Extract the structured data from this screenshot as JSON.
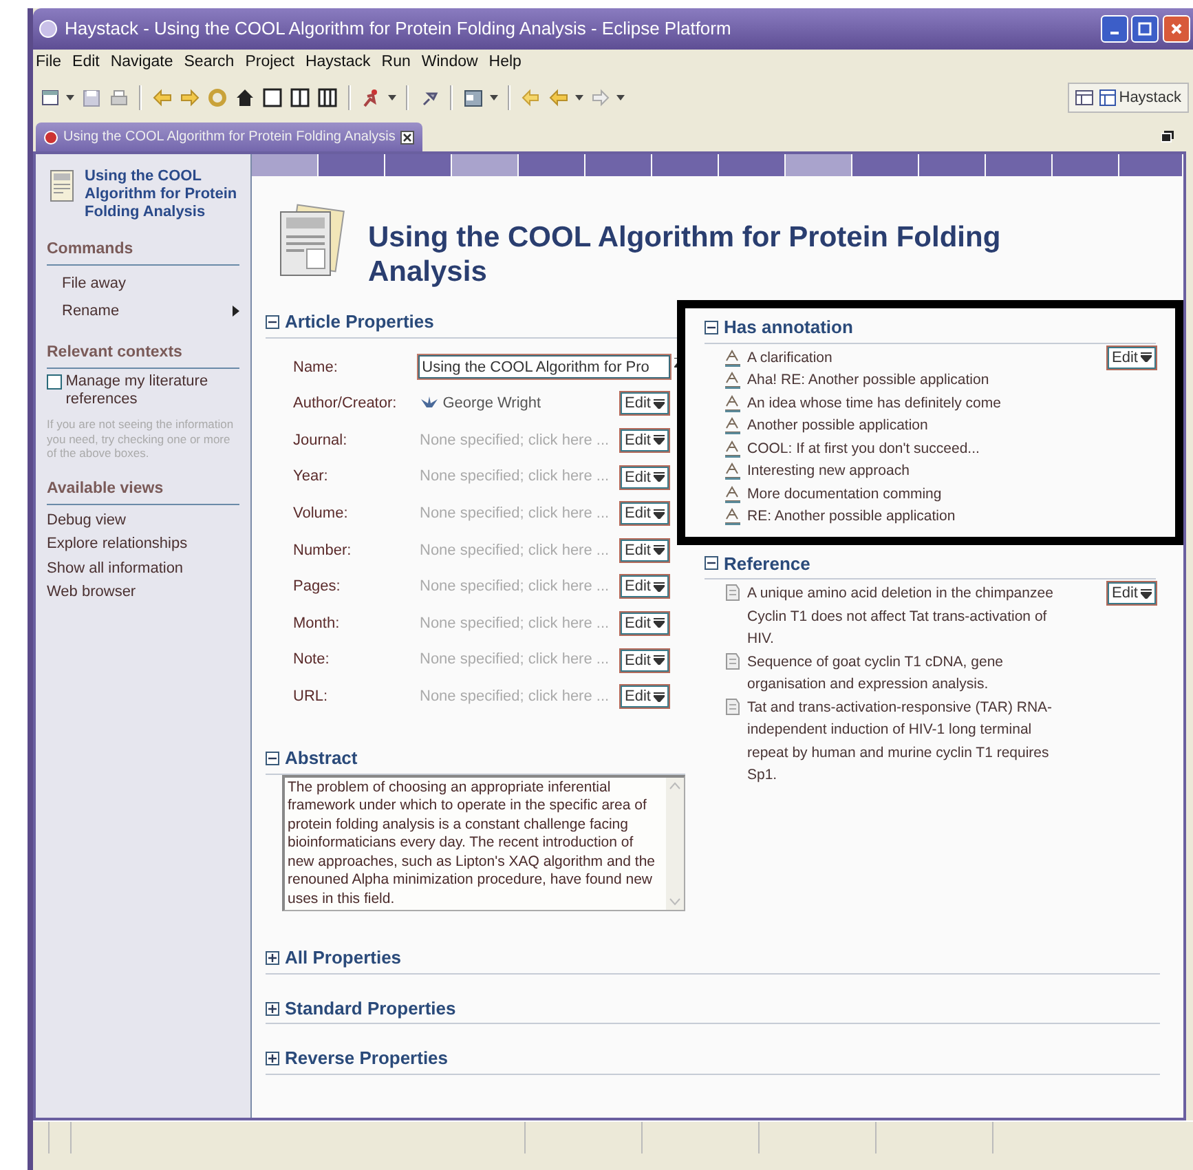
{
  "window": {
    "title": "Haystack - Using the COOL Algorithm for Protein Folding Analysis - Eclipse Platform"
  },
  "menu": [
    "File",
    "Edit",
    "Navigate",
    "Search",
    "Project",
    "Haystack",
    "Run",
    "Window",
    "Help"
  ],
  "perspective": "Haystack",
  "editor_tab": {
    "label": "Using the COOL Algorithm for Protein Folding Analysis"
  },
  "sidebar": {
    "title": "Using the COOL Algorithm for Protein Folding Analysis",
    "sections": [
      {
        "heading": "Commands",
        "kind": "commands",
        "items": [
          {
            "label": "File away",
            "submenu": false
          },
          {
            "label": "Rename",
            "submenu": true
          }
        ]
      },
      {
        "heading": "Relevant contexts",
        "kind": "contexts",
        "items": [
          {
            "label": "Manage my literature references",
            "checked": false
          }
        ],
        "hint": "If you are not seeing the information you need, try checking one or more of the above boxes."
      },
      {
        "heading": "Available views",
        "kind": "views",
        "items": [
          {
            "label": "Debug view"
          },
          {
            "label": "Explore relationships"
          },
          {
            "label": "Show all information"
          },
          {
            "label": "Web browser"
          }
        ]
      }
    ]
  },
  "main": {
    "title": "Using the COOL Algorithm for Protein Folding Analysis",
    "article_properties": {
      "heading": "Article Properties",
      "expanded": true,
      "rows": [
        {
          "label": "Name:",
          "kind": "field",
          "value": "Using the COOL Algorithm for Pro"
        },
        {
          "label": "Author/Creator:",
          "kind": "person",
          "value": "George Wright",
          "action": "Edit"
        },
        {
          "label": "Journal:",
          "kind": "empty",
          "value": "None specified; click here ...",
          "action": "Edit"
        },
        {
          "label": "Year:",
          "kind": "empty",
          "value": "None specified; click here ...",
          "action": "Edit"
        },
        {
          "label": "Volume:",
          "kind": "empty",
          "value": "None specified; click here ...",
          "action": "Edit"
        },
        {
          "label": "Number:",
          "kind": "empty",
          "value": "None specified; click here ...",
          "action": "Edit"
        },
        {
          "label": "Pages:",
          "kind": "empty",
          "value": "None specified; click here ...",
          "action": "Edit"
        },
        {
          "label": "Month:",
          "kind": "empty",
          "value": "None specified; click here ...",
          "action": "Edit"
        },
        {
          "label": "Note:",
          "kind": "empty",
          "value": "None specified; click here ...",
          "action": "Edit"
        },
        {
          "label": "URL:",
          "kind": "empty",
          "value": "None specified; click here ...",
          "action": "Edit"
        }
      ]
    },
    "abstract": {
      "heading": "Abstract",
      "expanded": true,
      "text": "The problem of choosing an appropriate inferential framework under which to operate in the specific area of protein folding analysis is a constant challenge facing bioinformaticians every day. The recent introduction of new approaches, such as Lipton's XAQ algorithm and the renouned Alpha minimization procedure, have found new uses in this field."
    },
    "collapsed_sections": [
      {
        "heading": "All Properties",
        "expanded": false
      },
      {
        "heading": "Standard Properties",
        "expanded": false
      },
      {
        "heading": "Reverse Properties",
        "expanded": false
      }
    ],
    "has_annotation": {
      "heading": "Has annotation",
      "expanded": true,
      "highlighted": true,
      "action": "Edit",
      "items": [
        "A clarification",
        "Aha! RE: Another possible application",
        "An idea whose time has definitely come",
        "Another possible application",
        "COOL: If at first you don't succeed...",
        "Interesting new approach",
        "More documentation comming",
        "RE: Another possible application"
      ]
    },
    "reference": {
      "heading": "Reference",
      "expanded": true,
      "highlighted": false,
      "action": "Edit",
      "items": [
        "A unique amino acid deletion in the chimpanzee Cyclin T1 does not affect Tat trans-activation of HIV.",
        "Sequence of goat cyclin T1 cDNA, gene organisation and expression analysis.",
        "Tat and trans-activation-responsive (TAR) RNA-independent induction of HIV-1 long terminal repeat by human and murine cyclin T1 requires Sp1."
      ]
    }
  }
}
